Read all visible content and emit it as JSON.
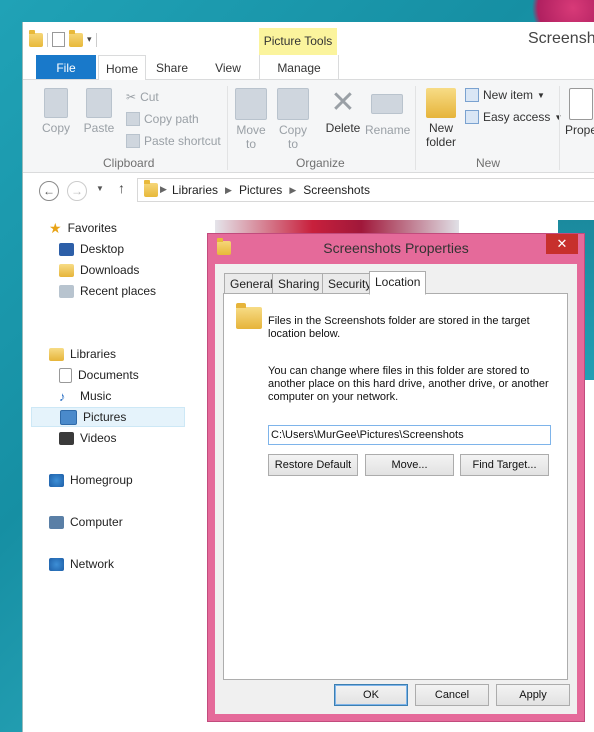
{
  "explorer": {
    "window_title": "Screenshots",
    "contextual_tab": "Picture Tools",
    "tabs": {
      "file": "File",
      "home": "Home",
      "share": "Share",
      "view": "View",
      "manage": "Manage"
    },
    "ribbon": {
      "copy": "Copy",
      "paste": "Paste",
      "cut": "Cut",
      "copy_path": "Copy path",
      "paste_shortcut": "Paste shortcut",
      "clipboard_group": "Clipboard",
      "move_to": "Move",
      "move_to_2": "to",
      "copy_to": "Copy",
      "copy_to_2": "to",
      "delete": "Delete",
      "rename": "Rename",
      "organize_group": "Organize",
      "new_folder": "New",
      "new_folder_2": "folder",
      "new_item": "New item",
      "easy_access": "Easy access",
      "new_group": "New",
      "properties": "Prope"
    },
    "breadcrumb": [
      "Libraries",
      "Pictures",
      "Screenshots"
    ],
    "nav": {
      "favorites": "Favorites",
      "desktop": "Desktop",
      "downloads": "Downloads",
      "recent_places": "Recent places",
      "libraries": "Libraries",
      "documents": "Documents",
      "music": "Music",
      "pictures": "Pictures",
      "videos": "Videos",
      "homegroup": "Homegroup",
      "computer": "Computer",
      "network": "Network"
    }
  },
  "dialog": {
    "title": "Screenshots Properties",
    "close": "✕",
    "tabs": {
      "general": "General",
      "sharing": "Sharing",
      "security": "Security",
      "location": "Location"
    },
    "text1": "Files in the Screenshots folder are stored in the target location below.",
    "text2": "You can change where files in this folder are stored to another place on this hard drive, another drive, or another computer on your network.",
    "path_value": "C:\\Users\\MurGee\\Pictures\\Screenshots",
    "restore_default": "Restore Default",
    "move": "Move...",
    "find_target": "Find Target...",
    "ok": "OK",
    "cancel": "Cancel",
    "apply": "Apply"
  }
}
